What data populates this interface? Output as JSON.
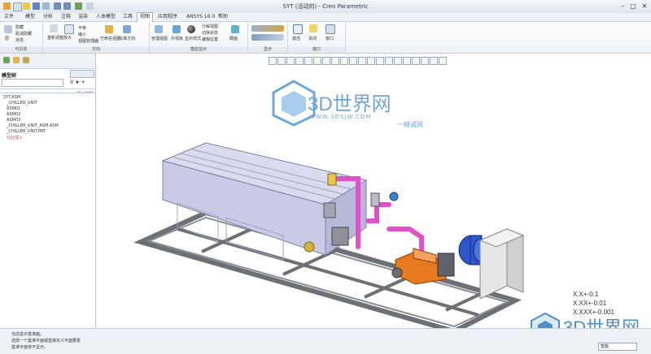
{
  "window": {
    "title": "SYT (活动的) - Creo Parametric",
    "controls": [
      "minimize",
      "maximize",
      "close"
    ]
  },
  "menu_tabs": [
    "文件",
    "模型",
    "分析",
    "注释",
    "渲染",
    "人体模型",
    "工具",
    "视图",
    "应用程序",
    "ANSYS 16.0",
    "帮助"
  ],
  "active_tab": "视图",
  "ribbon": {
    "groups": [
      "可见性",
      "方向",
      "模型显示",
      "显示",
      "窗口"
    ],
    "visibility": [
      "层",
      "隐藏",
      "取消隐藏",
      "状态"
    ],
    "orientation": [
      "重新调整",
      "放大",
      "缩小",
      "平移",
      "已命名视图",
      "标准方向",
      "视图管理器"
    ],
    "model_display": [
      "管理视图",
      "外观库",
      "显示样式",
      "分解视图",
      "切换状态",
      "编辑位置",
      "截面"
    ],
    "window": [
      "激活",
      "关闭",
      "窗口"
    ]
  },
  "sidebar": {
    "title": "模型树",
    "tree_header": "ptc_comm",
    "items": [
      "SYT.ASM",
      "_CHILLER_UNIT",
      "ASM01",
      "ASM02",
      "ASM03",
      "_CHILLER_UNIT_ASM.ASM",
      "_CHILLER_UNIT.PRT",
      "在此插入"
    ]
  },
  "watermark": {
    "text": "3D世界网",
    "url": "WWW.3DSJW.COM",
    "slogan": "一精诚网"
  },
  "tolerance": [
    "X.X+-0.1",
    "X.XX+-0.01",
    "X.XXX+-0.001"
  ],
  "status_messages": [
    "当前显示基准面。",
    "选择一个基准平面或直接定义平面要素",
    "基准平面将不显示。"
  ],
  "status_right": "智能",
  "colors": {
    "frame": "#6d7075",
    "tank": "#c9cbe6",
    "pipe": "#e24fc8",
    "pump": "#e7791f",
    "motor": "#2f56c7"
  }
}
